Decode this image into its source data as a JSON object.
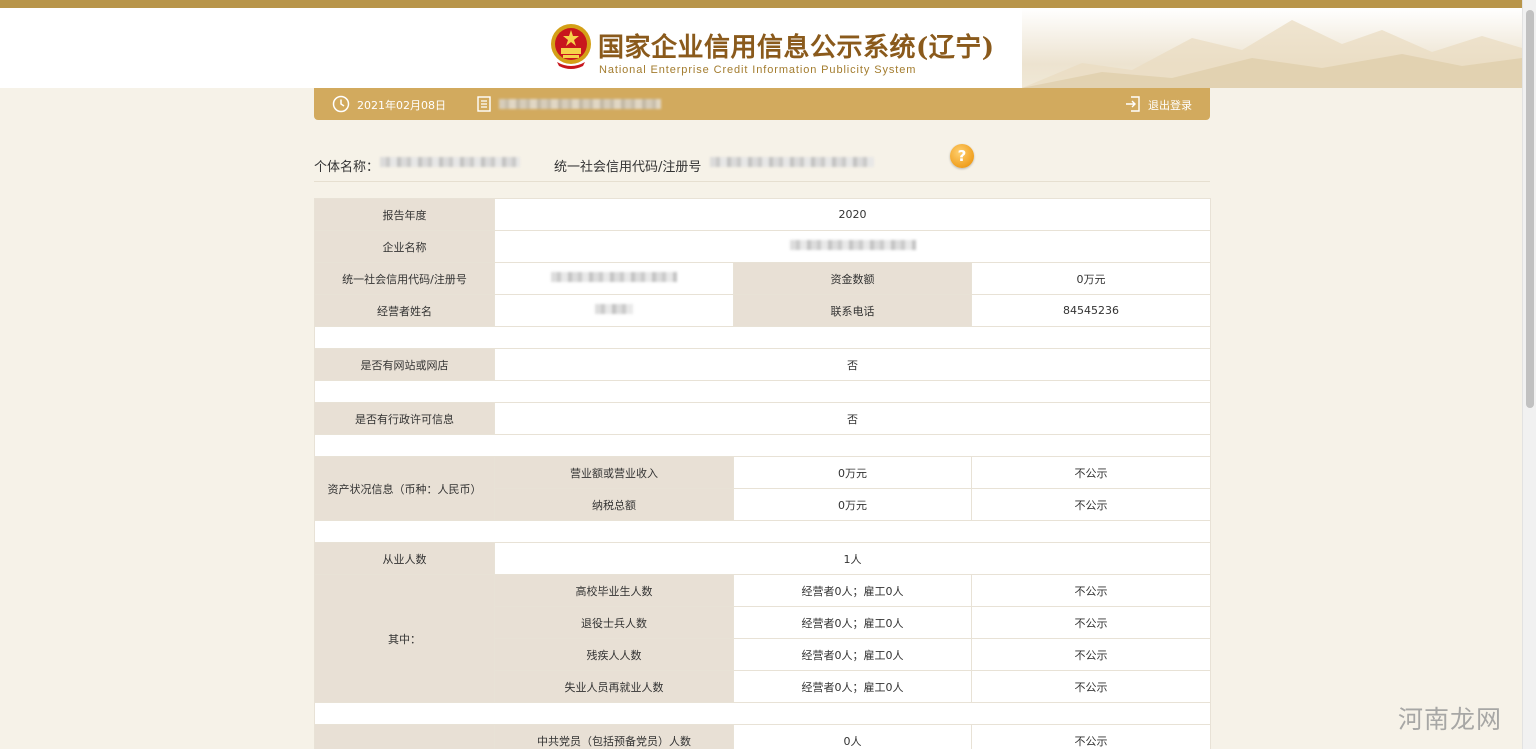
{
  "header": {
    "title_cn": "国家企业信用信息公示系统(辽宁)",
    "title_en": "National Enterprise Credit Information Publicity System"
  },
  "toolbar": {
    "date": "2021年02月08日",
    "logout_label": "退出登录"
  },
  "info": {
    "name_label": "个体名称：",
    "code_label": "统一社会信用代码/注册号",
    "help_glyph": "?"
  },
  "report": {
    "year_label": "报告年度",
    "year_value": "2020",
    "company_label": "企业名称",
    "code_label": "统一社会信用代码/注册号",
    "capital_label": "资金数额",
    "capital_value": "0万元",
    "operator_label": "经营者姓名",
    "phone_label": "联系电话",
    "phone_value": "84545236",
    "website_label": "是否有网站或网店",
    "website_value": "否",
    "license_label": "是否有行政许可信息",
    "license_value": "否",
    "assets_label": "资产状况信息（币种：人民币）",
    "revenue_label": "营业额或营业收入",
    "revenue_value": "0万元",
    "revenue_public": "不公示",
    "tax_label": "纳税总额",
    "tax_value": "0万元",
    "tax_public": "不公示",
    "employees_label": "从业人数",
    "employees_value": "1人",
    "among_label": "其中：",
    "sub_rows": [
      {
        "label": "高校毕业生人数",
        "value": "经营者0人；雇工0人",
        "public": "不公示"
      },
      {
        "label": "退役士兵人数",
        "value": "经营者0人；雇工0人",
        "public": "不公示"
      },
      {
        "label": "残疾人人数",
        "value": "经营者0人；雇工0人",
        "public": "不公示"
      },
      {
        "label": "失业人员再就业人数",
        "value": "经营者0人；雇工0人",
        "public": "不公示"
      }
    ],
    "party_label": "中共党员（包括预备党员）人数",
    "party_value": "0人",
    "party_public": "不公示"
  },
  "watermark": "河南龙网"
}
